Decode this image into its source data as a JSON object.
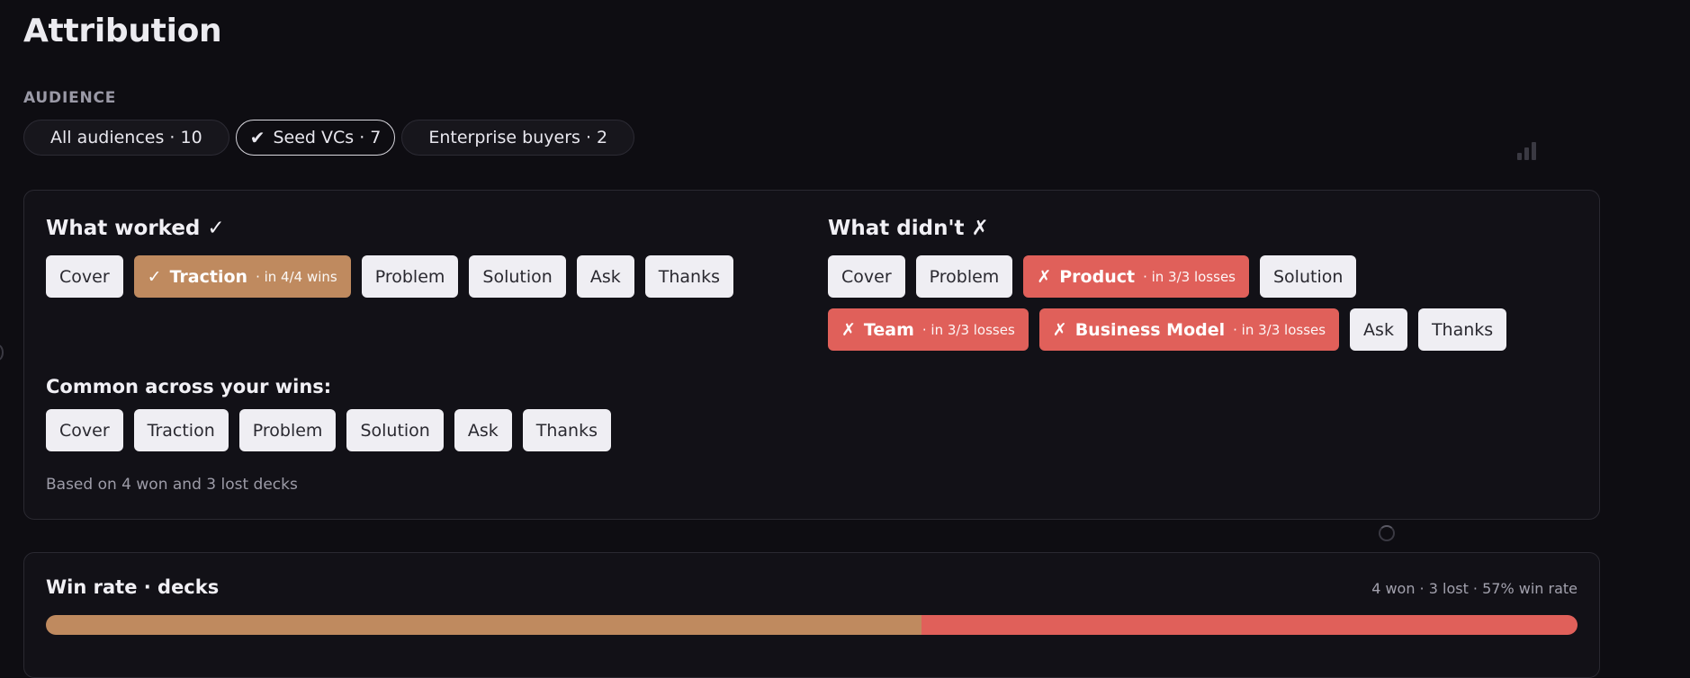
{
  "page": {
    "title": "Attribution"
  },
  "audience": {
    "label": "AUDIENCE",
    "options": [
      {
        "label": "All audiences · 10",
        "selected": false
      },
      {
        "label": "Seed VCs · 7",
        "selected": true
      },
      {
        "label": "Enterprise buyers · 2",
        "selected": false
      }
    ]
  },
  "what_worked": {
    "title": "What worked ✓",
    "chips": [
      {
        "label": "Cover"
      },
      {
        "mark": "✓",
        "label": "Traction",
        "meta": "· in 4/4 wins"
      },
      {
        "label": "Problem"
      },
      {
        "label": "Solution"
      },
      {
        "label": "Ask"
      },
      {
        "label": "Thanks"
      }
    ]
  },
  "what_didnt": {
    "title": "What didn't ✗",
    "chips": [
      {
        "label": "Cover"
      },
      {
        "label": "Problem"
      },
      {
        "mark": "✗",
        "label": "Product",
        "meta": "· in 3/3 losses"
      },
      {
        "label": "Solution"
      },
      {
        "mark": "✗",
        "label": "Team",
        "meta": "· in 3/3 losses"
      },
      {
        "mark": "✗",
        "label": "Business Model",
        "meta": "· in 3/3 losses"
      },
      {
        "label": "Ask"
      },
      {
        "label": "Thanks"
      }
    ]
  },
  "common": {
    "title": "Common across your wins:",
    "chips": [
      "Cover",
      "Traction",
      "Problem",
      "Solution",
      "Ask",
      "Thanks"
    ]
  },
  "footnote": "Based on 4 won and 3 lost decks",
  "win_rate": {
    "title": "Win rate · decks",
    "summary": "4 won · 3 lost · 57% win rate",
    "won": 4,
    "lost": 3,
    "won_fraction": 0.5714
  },
  "colors": {
    "background": "#0e0d12",
    "win_accent": "#bf8a5f",
    "loss_accent": "#e0605a",
    "chip_neutral": "#efeef3"
  },
  "icons": {
    "selected_check": "check-icon",
    "stats": "bar-chart-icon",
    "loading": "spinner-icon"
  }
}
